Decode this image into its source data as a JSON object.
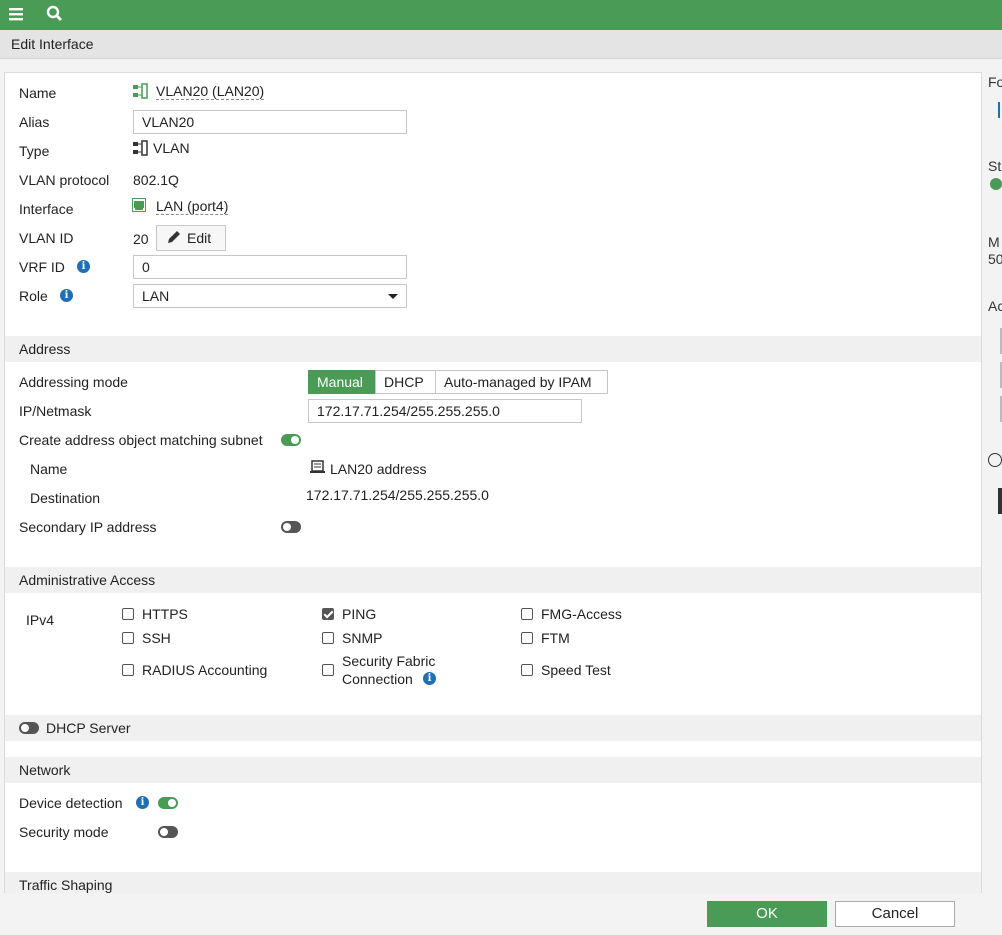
{
  "page_title": "Edit Interface",
  "general": {
    "name_label": "Name",
    "name_value": "VLAN20 (LAN20)",
    "alias_label": "Alias",
    "alias_value": "VLAN20",
    "type_label": "Type",
    "type_value": "VLAN",
    "vlan_protocol_label": "VLAN protocol",
    "vlan_protocol_value": "802.1Q",
    "interface_label": "Interface",
    "interface_value": "LAN (port4)",
    "vlan_id_label": "VLAN ID",
    "vlan_id_value": "20",
    "edit_label": "Edit",
    "vrf_id_label": "VRF ID",
    "vrf_id_value": "0",
    "role_label": "Role",
    "role_value": "LAN"
  },
  "address": {
    "section_title": "Address",
    "mode_label": "Addressing mode",
    "modes": [
      "Manual",
      "DHCP",
      "Auto-managed by IPAM"
    ],
    "active_mode": "Manual",
    "ip_label": "IP/Netmask",
    "ip_value": "172.17.71.254/255.255.255.0",
    "create_obj_label": "Create address object matching subnet",
    "create_obj_enabled": true,
    "obj_name_label": "Name",
    "obj_name_value": "LAN20 address",
    "destination_label": "Destination",
    "destination_value": "172.17.71.254/255.255.255.0",
    "secondary_label": "Secondary IP address",
    "secondary_enabled": false
  },
  "admin_access": {
    "section_title": "Administrative Access",
    "ipv4_label": "IPv4",
    "items": [
      {
        "label": "HTTPS",
        "checked": false
      },
      {
        "label": "PING",
        "checked": true
      },
      {
        "label": "FMG-Access",
        "checked": false
      },
      {
        "label": "SSH",
        "checked": false
      },
      {
        "label": "SNMP",
        "checked": false
      },
      {
        "label": "FTM",
        "checked": false
      },
      {
        "label": "RADIUS Accounting",
        "checked": false
      },
      {
        "label": "Security Fabric Connection",
        "label_line1": "Security Fabric",
        "label_line2": "Connection",
        "checked": false
      },
      {
        "label": "Speed Test",
        "checked": false
      }
    ]
  },
  "dhcp": {
    "section_title": "DHCP Server",
    "enabled": false
  },
  "network": {
    "section_title": "Network",
    "device_detection_label": "Device detection",
    "device_detection_enabled": true,
    "security_mode_label": "Security mode",
    "security_mode_enabled": false
  },
  "traffic_shaping": {
    "section_title": "Traffic Shaping"
  },
  "footer": {
    "ok_label": "OK",
    "cancel_label": "Cancel"
  },
  "side_panel": {
    "text1": "Fo",
    "text2": "St",
    "text3": "M",
    "text4": "50",
    "text5": "Ac"
  },
  "colors": {
    "brand": "#4a9b56",
    "info": "#1f6fb5"
  }
}
